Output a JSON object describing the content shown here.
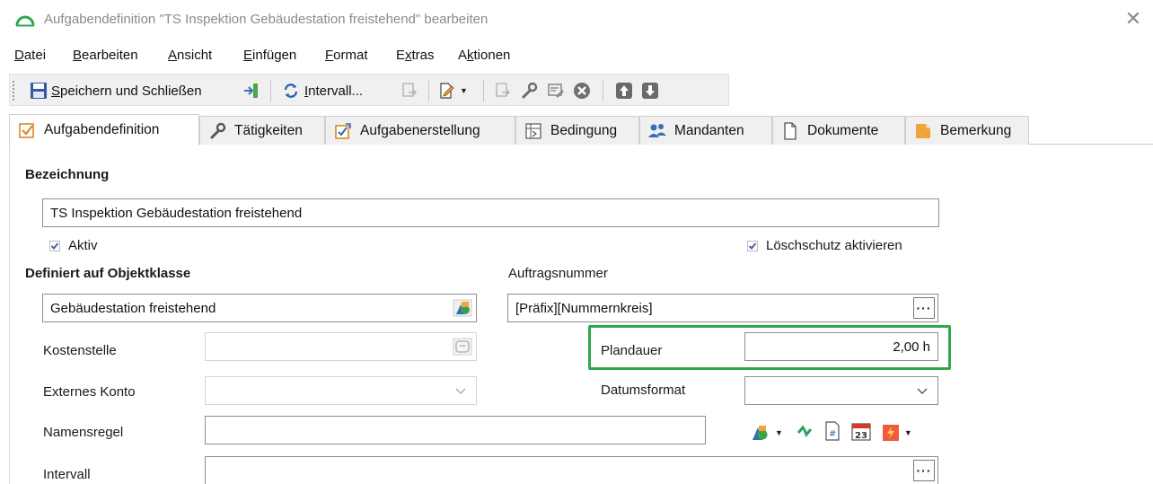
{
  "window": {
    "title": "Aufgabendefinition \"TS Inspektion Gebäudestation freistehend\" bearbeiten",
    "close_glyph": "✕"
  },
  "menu": [
    {
      "label": "Datei",
      "accel": "D",
      "rest": "atei"
    },
    {
      "label": "Bearbeiten",
      "accel": "B",
      "rest": "earbeiten"
    },
    {
      "label": "Ansicht",
      "accel": "A",
      "rest": "nsicht"
    },
    {
      "label": "Einfügen",
      "accel": "E",
      "rest": "infügen"
    },
    {
      "label": "Format",
      "accel": "F",
      "rest": "ormat"
    },
    {
      "label": "Extras",
      "pre": "E",
      "accel": "x",
      "rest": "tras"
    },
    {
      "label": "Aktionen",
      "pre": "A",
      "accel": "k",
      "rest": "tionen"
    }
  ],
  "toolbar": {
    "save_close": {
      "accel": "S",
      "rest": "peichern und Schließen"
    },
    "interval": {
      "accel": "I",
      "rest": "ntervall..."
    }
  },
  "tabs": [
    {
      "label": "Aufgabendefinition",
      "icon": "task-check-icon",
      "active": true
    },
    {
      "label": "Tätigkeiten",
      "icon": "wrench-icon",
      "active": false
    },
    {
      "label": "Aufgabenerstellung",
      "icon": "task-create-icon",
      "active": false
    },
    {
      "label": "Bedingung",
      "icon": "condition-icon",
      "active": false
    },
    {
      "label": "Mandanten",
      "icon": "users-icon",
      "active": false
    },
    {
      "label": "Dokumente",
      "icon": "document-icon",
      "active": false
    },
    {
      "label": "Bemerkung",
      "icon": "note-icon",
      "active": false
    }
  ],
  "form": {
    "bezeichnung_label": "Bezeichnung",
    "bezeichnung_value": "TS Inspektion Gebäudestation freistehend",
    "aktiv_label": "Aktiv",
    "aktiv_checked": true,
    "loeschschutz_label": "Löschschutz aktivieren",
    "loeschschutz_checked": true,
    "objektklasse_label": "Definiert auf Objektklasse",
    "objektklasse_value": "Gebäudestation freistehend",
    "auftragsnummer_label": "Auftragsnummer",
    "auftragsnummer_value": "[Präfix][Nummernkreis]",
    "kostenstelle_label": "Kostenstelle",
    "kostenstelle_value": "",
    "plandauer_label": "Plandauer",
    "plandauer_value": "2,00 h",
    "externes_konto_label": "Externes Konto",
    "externes_konto_value": "",
    "datumsformat_label": "Datumsformat",
    "datumsformat_value": "",
    "namensregel_label": "Namensregel",
    "namensregel_value": "",
    "intervall_label": "Intervall",
    "intervall_value": "",
    "ellipsis": "···"
  },
  "colors": {
    "highlight": "#2ea84b",
    "checkmark": "#4a5fb0",
    "accent_orange": "#f2a33a"
  }
}
